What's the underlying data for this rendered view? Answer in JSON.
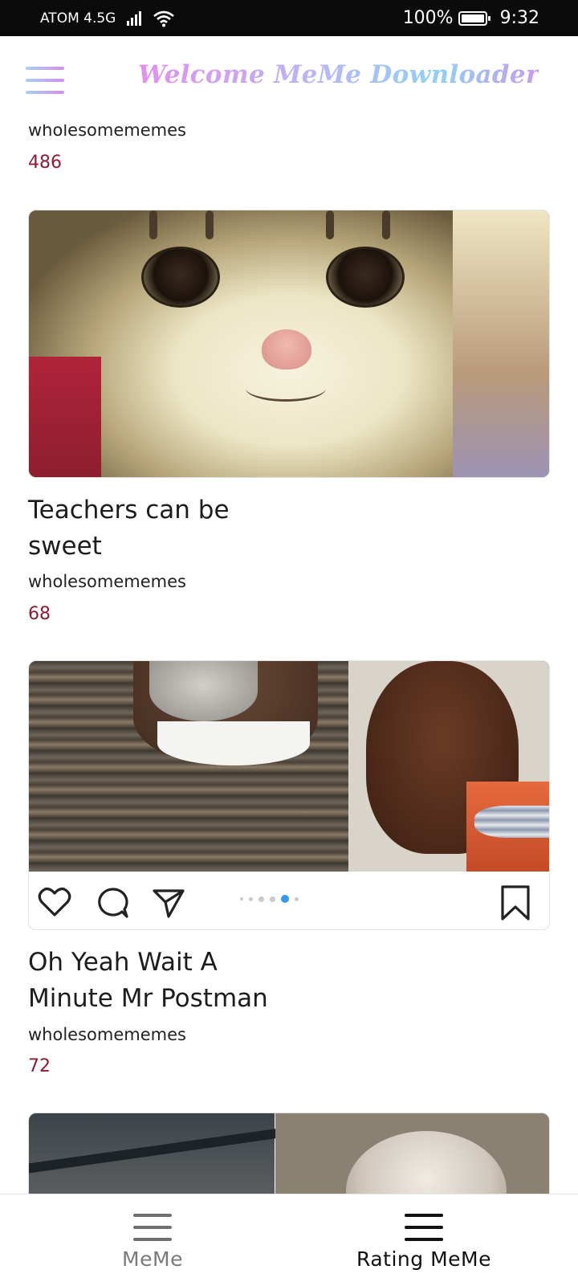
{
  "status_bar": {
    "carrier": "ATOM 4.5G",
    "battery": "100%",
    "time": "9:32"
  },
  "header": {
    "title": "Welcome MeMe Downloader",
    "menu_icon": "hamburger-menu-icon"
  },
  "feed": {
    "partial_top": {
      "subreddit": "wholesomememes",
      "upvotes": "486"
    },
    "posts": [
      {
        "title": "Teachers can be sweet",
        "subreddit": "wholesomememes",
        "upvotes": "68",
        "image": "smiling-cat-photo"
      },
      {
        "title": "Oh Yeah Wait A Minute Mr Postman",
        "subreddit": "wholesomememes",
        "upvotes": "72",
        "image": "grandpa-and-kid-photo"
      },
      {
        "image": "partial-meme-photo"
      }
    ]
  },
  "bottom_nav": {
    "items": [
      {
        "label": "MeMe",
        "icon": "menu-icon",
        "active": false
      },
      {
        "label": "Rating MeMe",
        "icon": "menu-icon",
        "active": true
      }
    ]
  },
  "colors": {
    "upvote": "#8e1b33",
    "nav_inactive": "#7a7a7a",
    "nav_active": "#111111",
    "title_gradient": [
      "#e48ef2",
      "#b8b7f7",
      "#8fd0f6",
      "#c79bf3"
    ]
  }
}
